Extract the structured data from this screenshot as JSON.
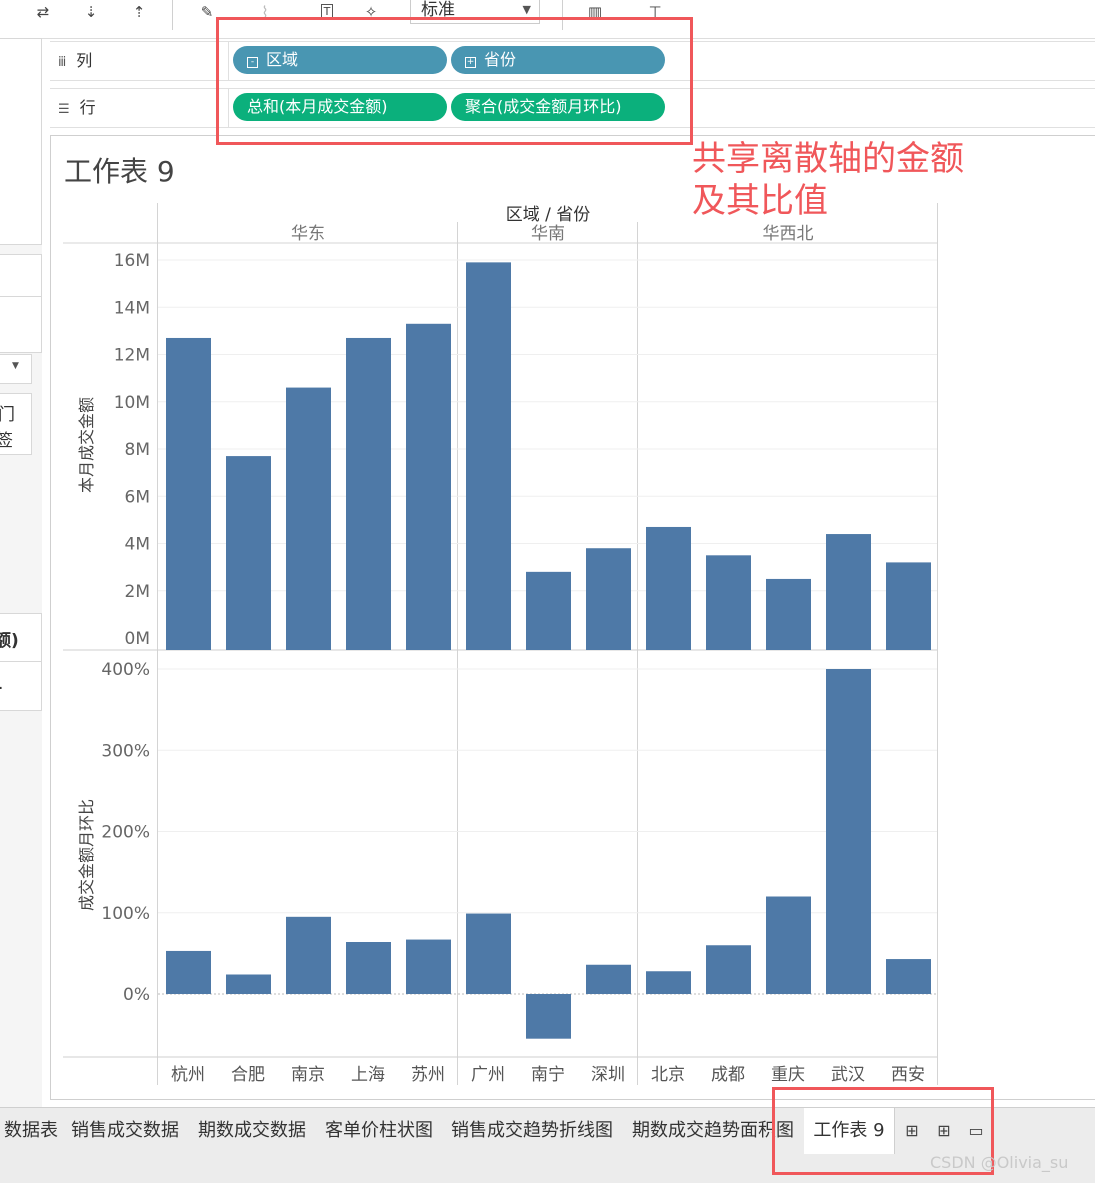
{
  "toolbar": {
    "fit_select": "标准",
    "icons": [
      "swap-icon",
      "sort-asc-icon",
      "sort-desc-icon",
      "highlight-icon",
      "attach-icon",
      "text-label-icon",
      "pin-icon",
      "chart-bar-icon",
      "presentation-icon"
    ]
  },
  "left_panel": {
    "fragment_1": "门",
    "fragment_2": "签",
    "fragment_3": "额)",
    "fragment_4": "."
  },
  "shelves": {
    "columns": {
      "label": "列",
      "pills": [
        "区域",
        "省份"
      ]
    },
    "rows": {
      "label": "行",
      "pills": [
        "总和(本月成交金额)",
        "聚合(成交金额月环比)"
      ]
    }
  },
  "annotation": {
    "line1": "共享离散轴的金额",
    "line2": "及其比值"
  },
  "sheet": {
    "title": "工作表 9",
    "header_title": "区域 / 省份"
  },
  "chart_data": {
    "type": "bar",
    "regions": [
      {
        "name": "华东",
        "provinces": [
          "杭州",
          "合肥",
          "南京",
          "上海",
          "苏州"
        ]
      },
      {
        "name": "华南",
        "provinces": [
          "广州",
          "南宁",
          "深圳"
        ]
      },
      {
        "name": "华西北",
        "provinces": [
          "北京",
          "成都",
          "重庆",
          "武汉",
          "西安"
        ]
      }
    ],
    "categories": [
      "杭州",
      "合肥",
      "南京",
      "上海",
      "苏州",
      "广州",
      "南宁",
      "深圳",
      "北京",
      "成都",
      "重庆",
      "武汉",
      "西安"
    ],
    "series": [
      {
        "name": "本月成交金额",
        "ylabel": "本月成交金额",
        "values": [
          12700000,
          7700000,
          10600000,
          12700000,
          13300000,
          15900000,
          2800000,
          3800000,
          4700000,
          3500000,
          2500000,
          4400000,
          3200000
        ],
        "ylim": [
          0,
          16000000
        ],
        "ticks": [
          0,
          2000000,
          4000000,
          6000000,
          8000000,
          10000000,
          12000000,
          14000000,
          16000000
        ],
        "tick_labels": [
          "0M",
          "2M",
          "4M",
          "6M",
          "8M",
          "10M",
          "12M",
          "14M",
          "16M"
        ]
      },
      {
        "name": "成交金额月环比",
        "ylabel": "成交金额月环比",
        "values": [
          0.53,
          0.24,
          0.95,
          0.64,
          0.67,
          0.99,
          -0.55,
          0.36,
          0.28,
          0.6,
          1.2,
          4.0,
          0.43
        ],
        "ylim": [
          -0.7,
          4.0
        ],
        "ticks": [
          0,
          1,
          2,
          3,
          4
        ],
        "tick_labels": [
          "0%",
          "100%",
          "200%",
          "300%",
          "400%"
        ]
      }
    ],
    "bar_color": "#4e79a7"
  },
  "tabs": [
    "数据表",
    "销售成交数据",
    "期数成交数据",
    "客单价柱状图",
    "销售成交趋势折线图",
    "期数成交趋势面积图",
    "工作表 9"
  ],
  "tab_icons": [
    "new-worksheet-icon",
    "new-dashboard-icon",
    "new-story-icon"
  ],
  "watermark": "CSDN @Olivia_su"
}
